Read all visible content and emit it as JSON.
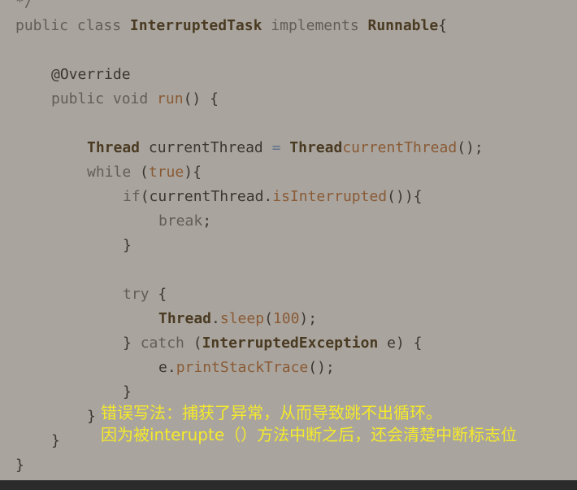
{
  "code": {
    "comment_tail": "*/",
    "lines": {
      "l1": {
        "a": "public class ",
        "b": "InterruptedTask",
        "c": " implements ",
        "d": "Runnable",
        "e": "{"
      },
      "l3": {
        "a": "@Override"
      },
      "l4": {
        "a": "public void ",
        "b": "run",
        "c": "() {"
      },
      "l6": {
        "a": "Thread",
        "b": " currentThread ",
        "c": "=",
        "d": " ",
        "e": "Thread",
        ".": ".",
        "f": "currentThread",
        "g": "();"
      },
      "l7": {
        "a": "while ",
        "b": "(",
        "c": "true",
        "d": "){"
      },
      "l8": {
        "a": "if",
        "b": "(currentThread.",
        "c": "isInterrupted",
        "d": "()){"
      },
      "l9": {
        "a": "break",
        ";": ";"
      },
      "l10": {
        "a": "}"
      },
      "l12": {
        "a": "try ",
        "b": "{"
      },
      "l13": {
        "a": "Thread",
        "b": ".",
        "c": "sleep",
        "d": "(",
        "e": "100",
        "f": ");"
      },
      "l14": {
        "a": "} ",
        "b": "catch ",
        "c": "(",
        "d": "InterruptedException",
        "e": " e) {"
      },
      "l15": {
        "a": "e.",
        "b": "printStackTrace",
        "c": "();"
      },
      "l16": {
        "a": "}"
      },
      "l17": {
        "a": "}"
      },
      "l18": {
        "a": "}"
      },
      "l19": {
        "a": "}"
      }
    }
  },
  "annotation": {
    "line1": "错误写法：捕获了异常，从而导致跳不出循环。",
    "line2": "因为被interupte（）方法中断之后，还会清楚中断标志位"
  },
  "colors": {
    "background": "#a9a59e",
    "keyword": "#625d57",
    "type": "#4a3a22",
    "method": "#8a5a35",
    "annotation_text": "#f5ea2a"
  }
}
